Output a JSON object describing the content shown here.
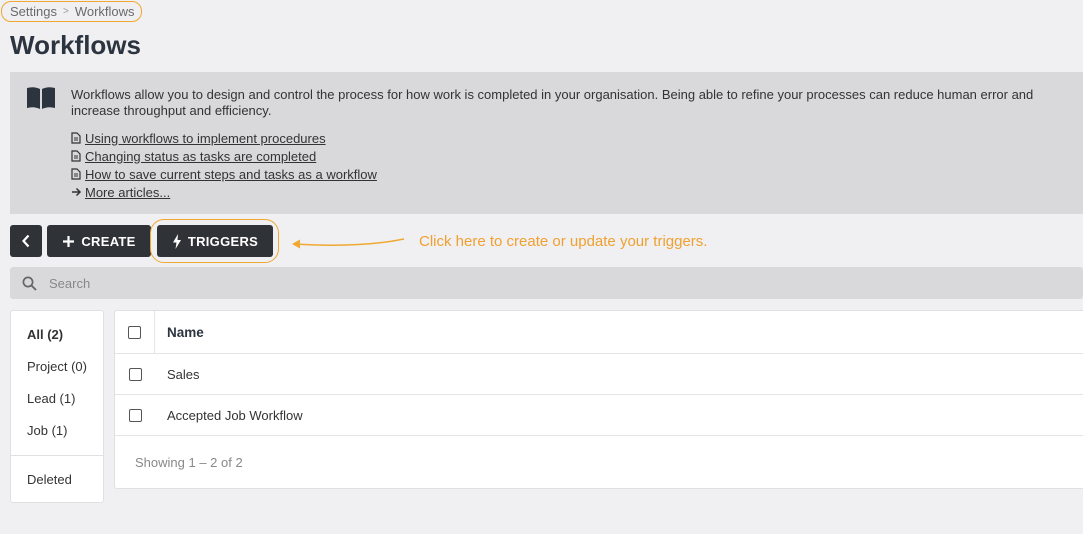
{
  "breadcrumb": {
    "items": [
      "Settings",
      "Workflows"
    ]
  },
  "page": {
    "title": "Workflows"
  },
  "info": {
    "description": "Workflows allow you to design and control the process for how work is completed in your organisation. Being able to refine your processes can reduce human error and increase throughput and efficiency.",
    "articles": [
      "Using workflows to implement procedures",
      "Changing status as tasks are completed",
      "How to save current steps and tasks as a workflow"
    ],
    "more_label": "More articles..."
  },
  "toolbar": {
    "create_label": "CREATE",
    "triggers_label": "TRIGGERS"
  },
  "callout": {
    "text": "Click here to create or update your triggers."
  },
  "search": {
    "placeholder": "Search"
  },
  "filters": {
    "items": [
      "All (2)",
      "Project (0)",
      "Lead (1)",
      "Job (1)"
    ],
    "deleted_label": "Deleted"
  },
  "table": {
    "header": "Name",
    "rows": [
      "Sales",
      "Accepted Job Workflow"
    ],
    "footer": "Showing 1 – 2 of 2"
  },
  "colors": {
    "accent": "#f0a830",
    "button_bg": "#2f3337",
    "panel_bg": "#d9d9dc"
  },
  "icons": [
    "book-icon",
    "document-icon",
    "arrow-right-icon",
    "chevron-left-icon",
    "plus-icon",
    "lightning-icon",
    "search-icon"
  ]
}
